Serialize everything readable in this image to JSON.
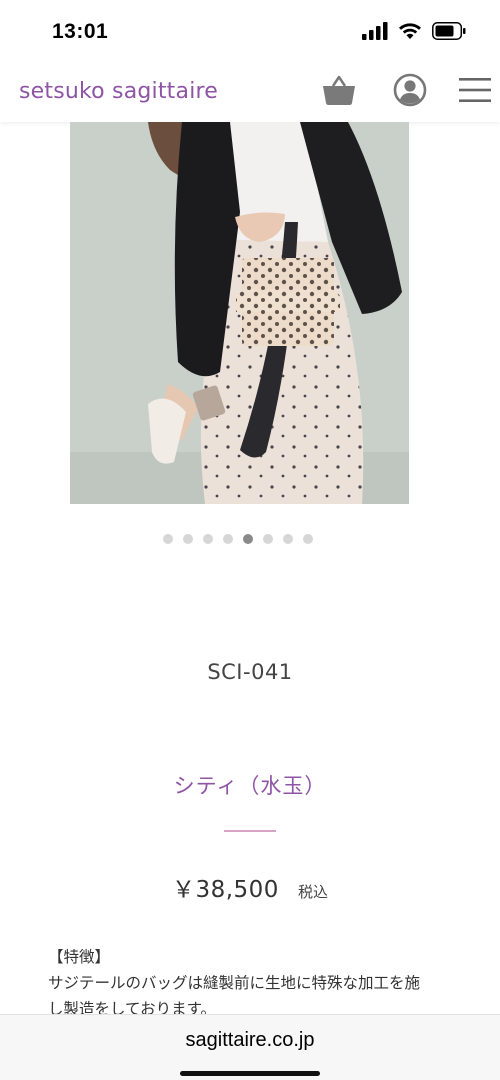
{
  "status": {
    "time": "13:01"
  },
  "header": {
    "logo": "setsuko sagittaire"
  },
  "carousel": {
    "count": 8,
    "active_index": 4
  },
  "product": {
    "code": "SCI-041",
    "name": "シティ（水玉）",
    "price": "￥38,500",
    "tax_label": "税込"
  },
  "features": {
    "heading": "【特徴】",
    "text_line1": "サジテールのバッグは縫製前に生地に特殊な加工を施",
    "text_line2": "し製造をしております。"
  },
  "browser": {
    "url": "sagittaire.co.jp"
  },
  "icons": {
    "cart": "shopping-basket-icon",
    "account": "user-circle-icon",
    "menu": "hamburger-menu-icon"
  },
  "colors": {
    "brand": "#8e55a5",
    "divider": "#d9a3c8"
  }
}
